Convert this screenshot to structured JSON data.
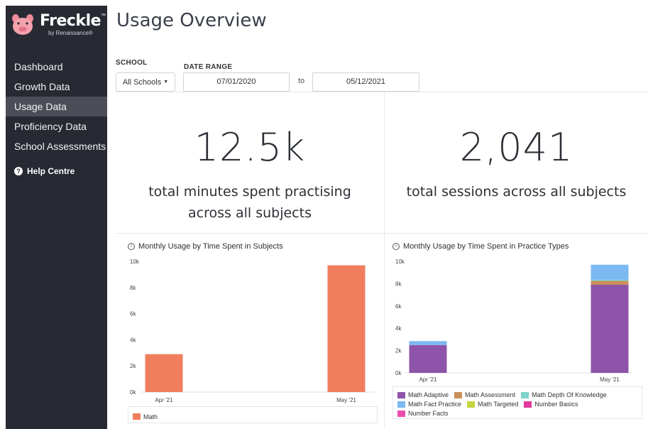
{
  "brand": {
    "name": "Freckle",
    "tm": "™",
    "subtitle": "by Renaissance®"
  },
  "sidebar": {
    "items": [
      {
        "label": "Dashboard",
        "active": false
      },
      {
        "label": "Growth Data",
        "active": false
      },
      {
        "label": "Usage Data",
        "active": true
      },
      {
        "label": "Proficiency Data",
        "active": false
      },
      {
        "label": "School Assessments",
        "active": false
      }
    ],
    "help": "Help Centre",
    "help_icon": "question-circle-icon"
  },
  "page": {
    "title": "Usage Overview"
  },
  "filters": {
    "school_label": "SCHOOL",
    "school_value": "All Schools",
    "date_range_label": "DATE RANGE",
    "start_date": "07/01/2020",
    "to_label": "to",
    "end_date": "05/12/2021"
  },
  "stats": {
    "minutes_value": "12.5k",
    "minutes_label_line1": "total minutes spent practising",
    "minutes_label_line2": "across all subjects",
    "sessions_value": "2,041",
    "sessions_label": "total sessions across all subjects"
  },
  "colors": {
    "sidebar_bg": "#272a33",
    "math": "#f07e5d",
    "math_adaptive": "#8e54a9",
    "math_assessment": "#c98f5a",
    "math_depth_of_knowledge": "#7fd3cb",
    "math_fact_practice": "#7cb8f2",
    "math_targeted": "#c4d53f",
    "number_basics": "#e0399a",
    "number_facts": "#ea4fb0"
  },
  "chart_data": [
    {
      "type": "bar",
      "title": "Monthly Usage by Time Spent in Subjects",
      "categories": [
        "Apr '21",
        "May '21"
      ],
      "series": [
        {
          "name": "Math",
          "color": "#f07e5d",
          "values": [
            2900,
            9700
          ]
        }
      ],
      "yticks": [
        "0k",
        "2k",
        "4k",
        "6k",
        "8k",
        "10k"
      ],
      "ylim": [
        0,
        10000
      ],
      "legend": "bottom"
    },
    {
      "type": "bar",
      "stacked": true,
      "title": "Monthly Usage by Time Spent in Practice Types",
      "categories": [
        "Apr '21",
        "May '21"
      ],
      "series": [
        {
          "name": "Math Adaptive",
          "color": "#8e54a9",
          "values": [
            2500,
            7900
          ]
        },
        {
          "name": "Math Assessment",
          "color": "#c98f5a",
          "values": [
            0,
            350
          ]
        },
        {
          "name": "Math Depth Of Knowledge",
          "color": "#7fd3cb",
          "values": [
            0,
            100
          ]
        },
        {
          "name": "Math Fact Practice",
          "color": "#7cb8f2",
          "values": [
            350,
            1350
          ]
        },
        {
          "name": "Math Targeted",
          "color": "#c4d53f",
          "values": [
            0,
            0
          ]
        },
        {
          "name": "Number Basics",
          "color": "#e0399a",
          "values": [
            0,
            0
          ]
        },
        {
          "name": "Number Facts",
          "color": "#ea4fb0",
          "values": [
            0,
            0
          ]
        }
      ],
      "yticks": [
        "0k",
        "2k",
        "4k",
        "6k",
        "8k",
        "10k"
      ],
      "ylim": [
        0,
        10000
      ],
      "legend": "bottom"
    }
  ]
}
